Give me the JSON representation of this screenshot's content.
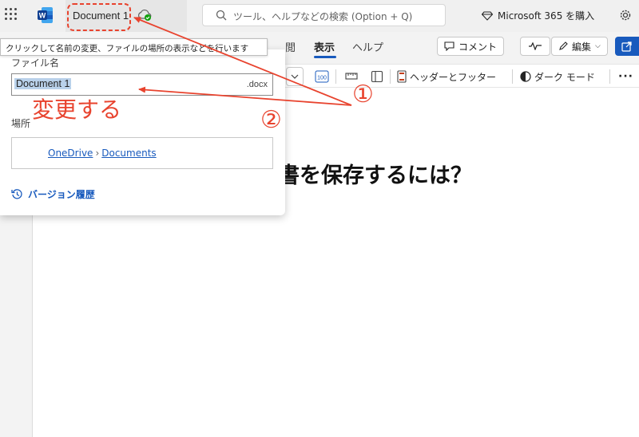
{
  "titlebar": {
    "document_name": "Document 1",
    "search_placeholder": "ツール、ヘルプなどの検索 (Option + Q)",
    "buy_label": "Microsoft 365 を購入"
  },
  "ribbon": {
    "tabs": [
      "閲",
      "表示",
      "ヘルプ"
    ],
    "comment_label": "コメント",
    "edit_label": "編集"
  },
  "toolbar": {
    "headers_footers": "ヘッダーとフッター",
    "dark_mode": "ダーク モード"
  },
  "tooltip": "クリックして名前の変更、ファイルの場所の表示などを行います",
  "flyout": {
    "filename_label": "ファイル名",
    "filename_value": "Document 1",
    "extension": ".docx",
    "location_label": "場所",
    "location_path": [
      "OneDrive",
      "Documents"
    ],
    "version_history": "バージョン履歴"
  },
  "document": {
    "heading": "書を保存するには？"
  },
  "annotations": {
    "change_note": "変更する",
    "marker_1": "①",
    "marker_2": "②",
    "color": "#e8432e"
  }
}
